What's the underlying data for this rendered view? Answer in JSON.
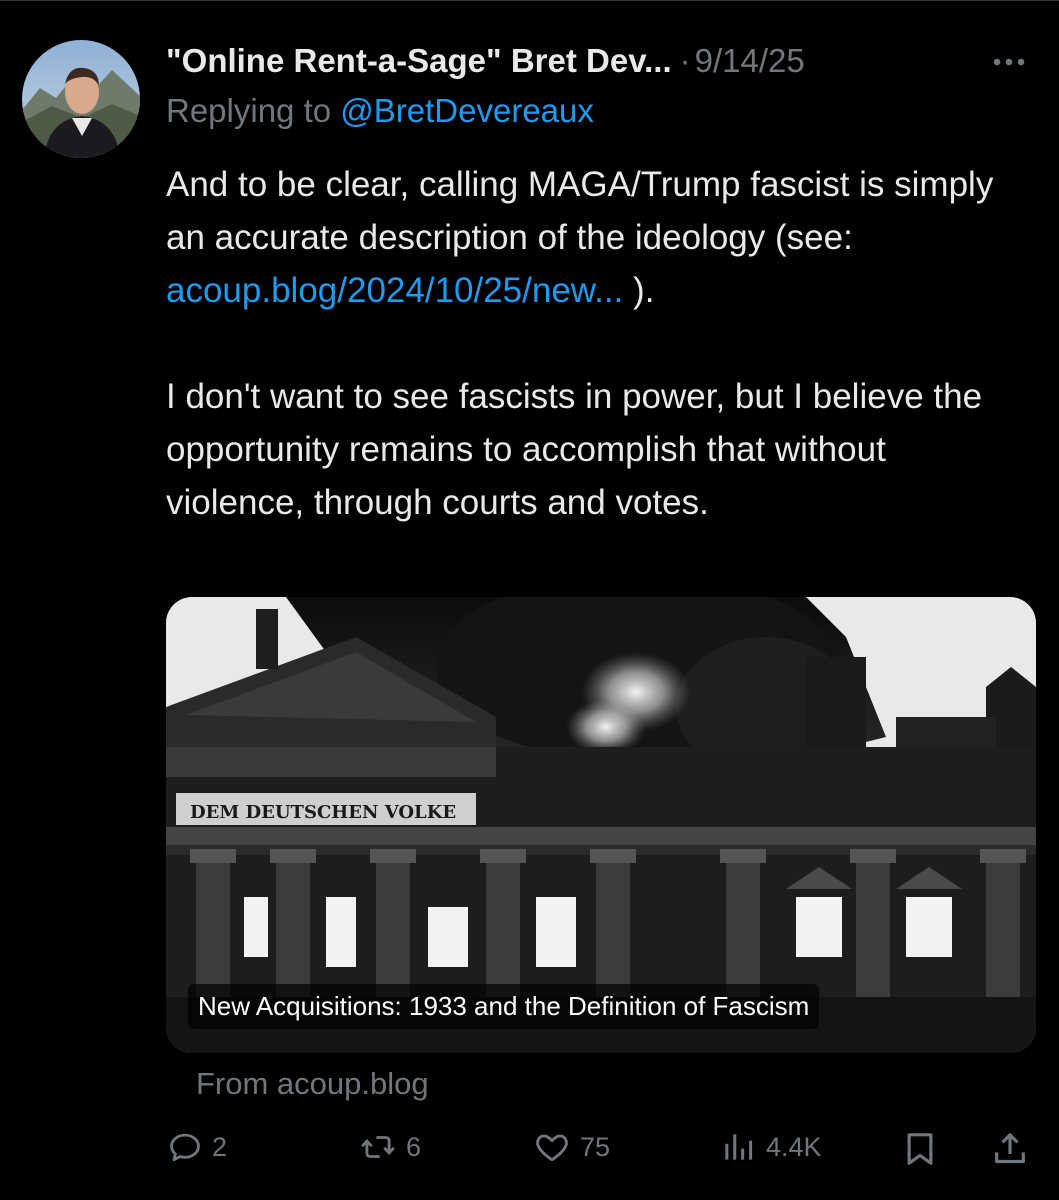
{
  "tweet": {
    "display_name": "\"Online Rent-a-Sage\" Bret Dev...",
    "separator": "·",
    "timestamp": "9/14/25",
    "replying_prefix": "Replying to ",
    "replying_handle": "@BretDevereaux",
    "text_p1_before": "And to be clear, calling MAGA/Trump fascist is simply an accurate description of the ideology (see: ",
    "text_p1_link": "acoup.blog/2024/10/25/new...",
    "text_p1_after": " ).",
    "text_p2": "I don't want to see fascists in power, but I believe the opportunity remains to accomplish that without violence, through courts and votes."
  },
  "card": {
    "title": "New Acquisitions: 1933 and the Definition of Fascism",
    "inscription": "DEM DEUTSCHEN VOLKE",
    "source": "From acoup.blog"
  },
  "actions": {
    "replies": "2",
    "reposts": "6",
    "likes": "75",
    "views": "4.4K"
  },
  "icons": [
    "more-icon",
    "reply-icon",
    "repost-icon",
    "like-icon",
    "views-icon",
    "bookmark-icon",
    "share-icon"
  ],
  "colors": {
    "background": "#000000",
    "text": "#e7e9ea",
    "secondary": "#71767b",
    "link": "#1d9bf0"
  }
}
